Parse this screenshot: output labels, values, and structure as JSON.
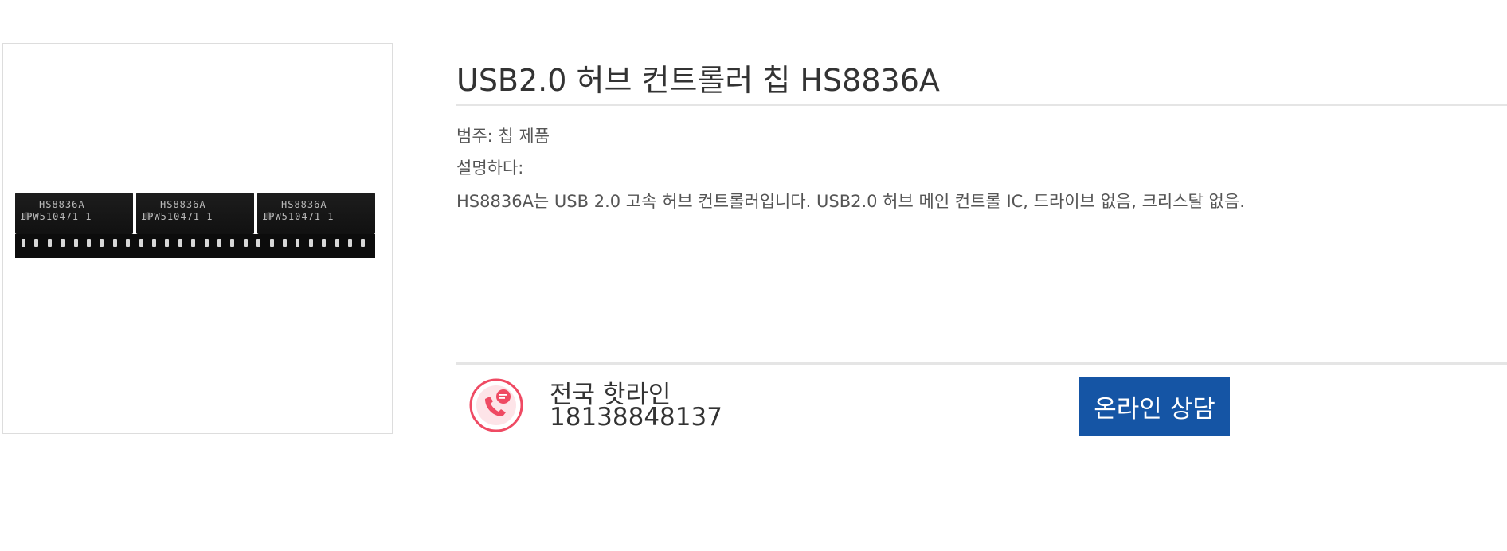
{
  "product": {
    "title": "USB2.0 허브 컨트롤러 칩 HS8836A",
    "image": {
      "chip_marking": "HS8836A",
      "chip_code": "IPW510471-1"
    },
    "category_label": "범주: 칩 제품",
    "description_label": "설명하다:",
    "description": "HS8836A는 USB 2.0 고속 허브 컨트롤러입니다. USB2.0 허브 메인 컨트롤 IC, 드라이브 없음, 크리스탈 없음."
  },
  "contact": {
    "icon": "phone-chat-icon",
    "hotline_label": "전국 핫라인",
    "hotline_number": "18138848137",
    "consult_button": "온라인 상담"
  },
  "colors": {
    "accent": "#1555a5",
    "icon_red": "#ef4a63"
  }
}
